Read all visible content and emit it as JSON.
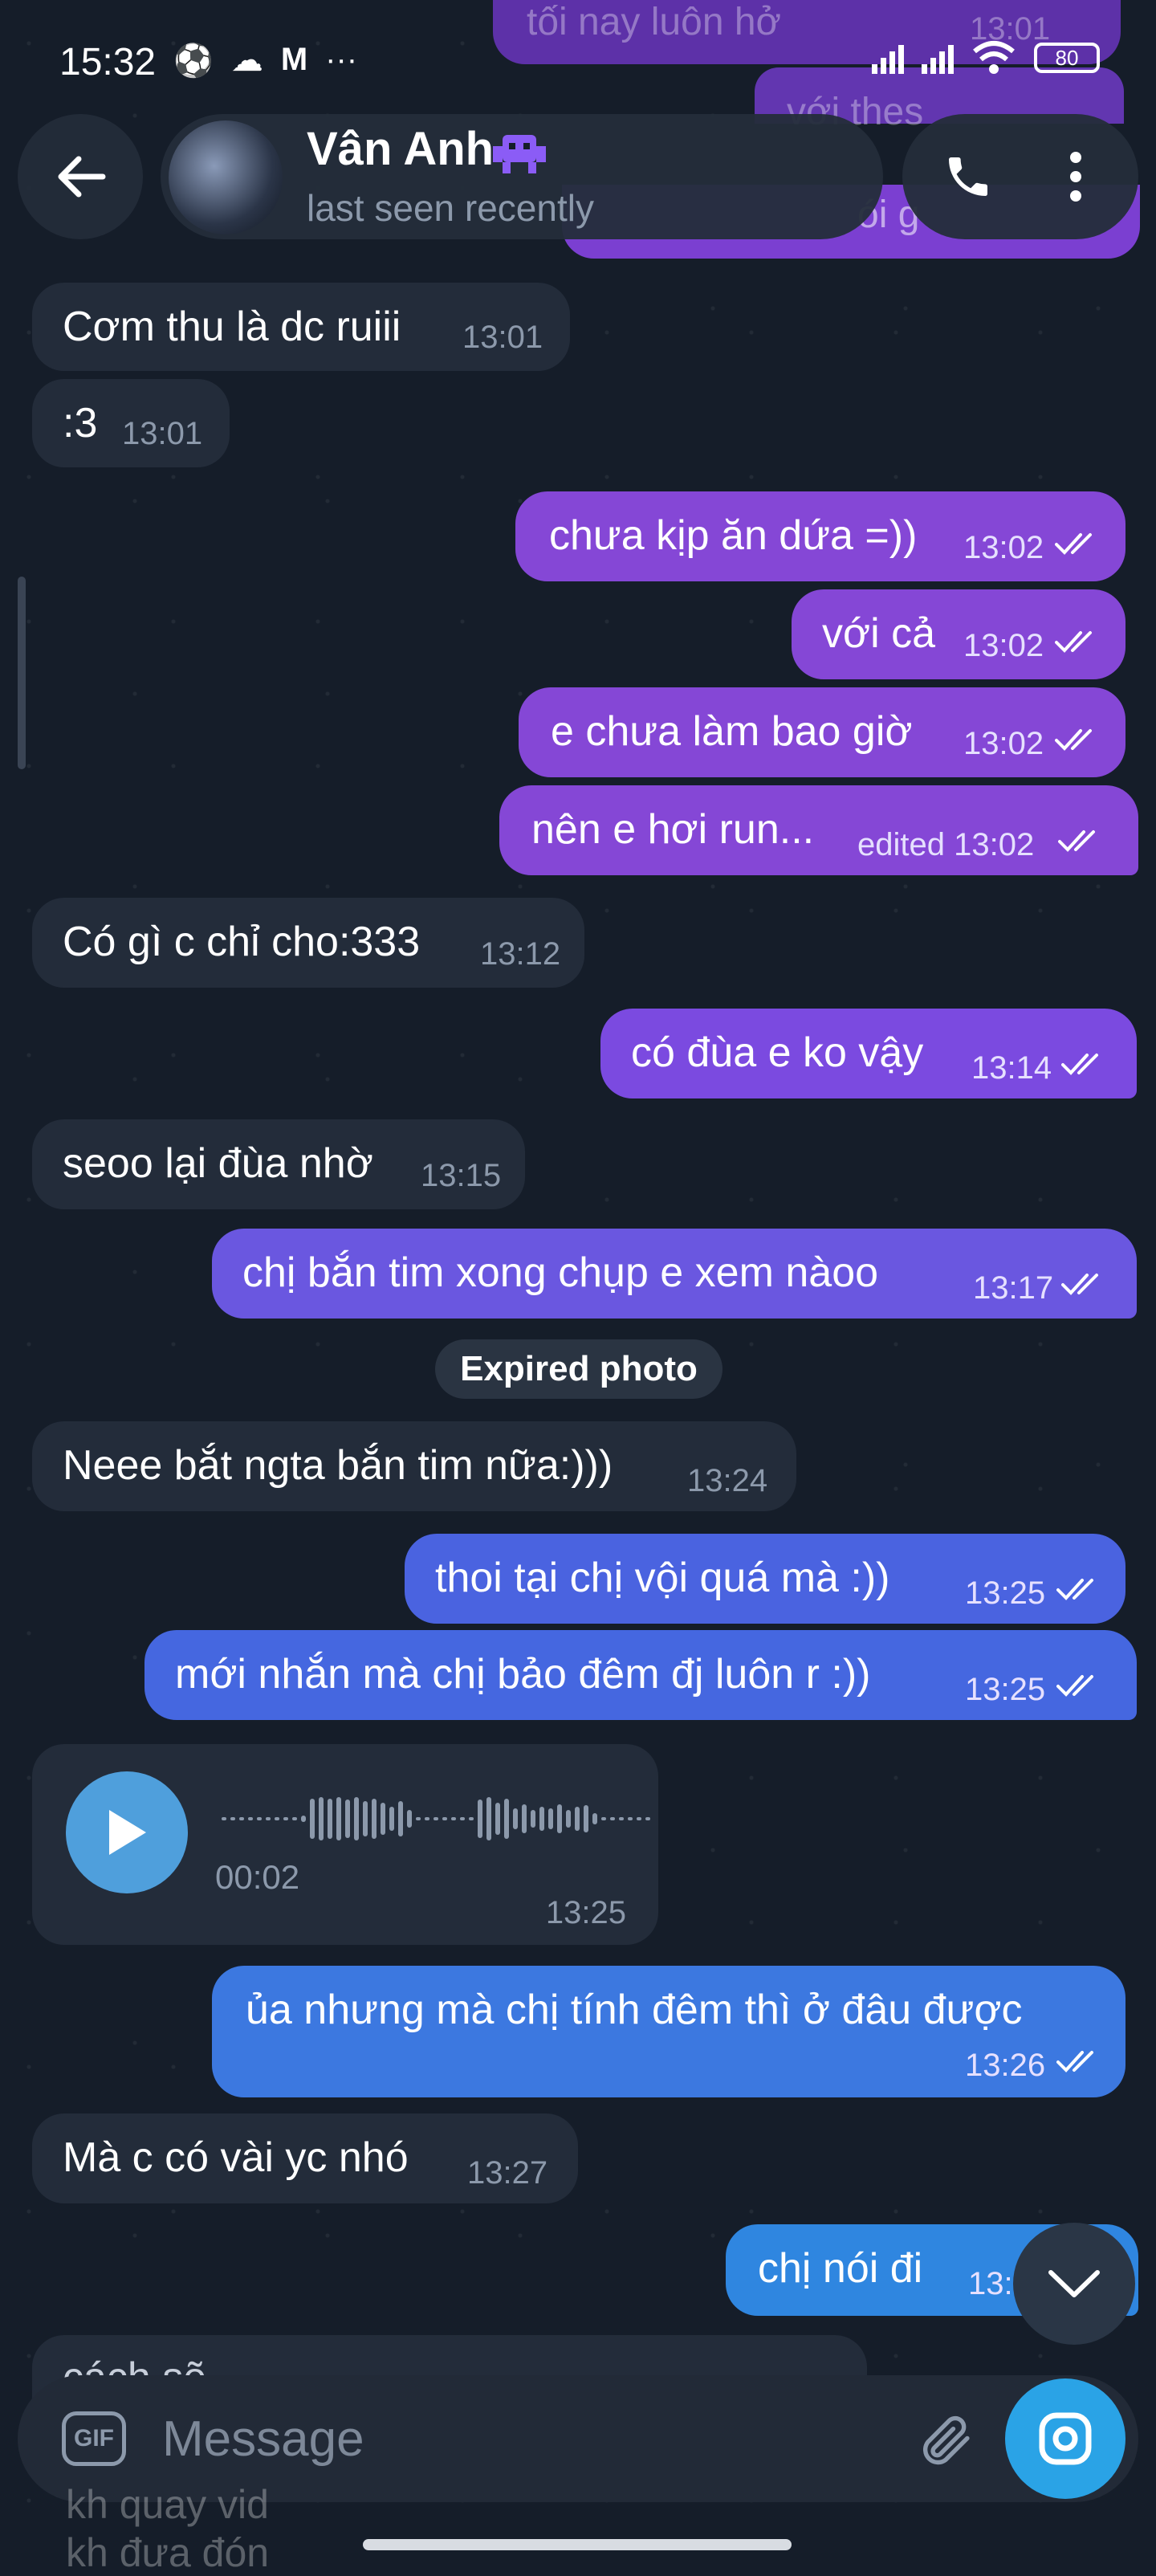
{
  "status_bar": {
    "time": "15:32",
    "battery": "80",
    "icons": [
      "soccer-ball-icon",
      "cloud-icon",
      "gmail-icon",
      "more-dots-icon",
      "signal-icon",
      "signal-icon",
      "wifi-icon",
      "battery-icon"
    ]
  },
  "header": {
    "contact_name": "Vân Anh",
    "contact_status": "last seen recently"
  },
  "background_messages": [
    {
      "text": "tối nay luôn hở",
      "time": "13:01"
    },
    {
      "text": "với thes"
    },
    {
      "text": "ói g"
    }
  ],
  "messages": [
    {
      "dir": "in",
      "text": "Cơm thu là dc ruiii",
      "time": "13:01"
    },
    {
      "dir": "in",
      "text": ":3",
      "time": "13:01"
    },
    {
      "dir": "out",
      "text": "chưa kịp ăn dứa =))",
      "time": "13:02"
    },
    {
      "dir": "out",
      "text": "với cả",
      "time": "13:02"
    },
    {
      "dir": "out",
      "text": "e chưa làm bao giờ",
      "time": "13:02"
    },
    {
      "dir": "out",
      "text": "nên e hơi run...",
      "time": "edited 13:02"
    },
    {
      "dir": "in",
      "text": "Có gì c chỉ cho:333",
      "time": "13:12"
    },
    {
      "dir": "out",
      "text": "có đùa e ko vậy",
      "time": "13:14"
    },
    {
      "dir": "in",
      "text": "seoo lại đùa nhờ",
      "time": "13:15"
    },
    {
      "dir": "out",
      "text": "chị bắn tim xong chụp e xem nàoo",
      "time": "13:17"
    },
    {
      "dir": "in",
      "text": "Neee bắt ngta bắn tim nữa:)))",
      "time": "13:24"
    },
    {
      "dir": "out",
      "text": "thoi tại chị vội quá mà :))",
      "time": "13:25"
    },
    {
      "dir": "out",
      "text": "mới nhắn mà chị bảo đêm đj luôn r :))",
      "time": "13:25"
    },
    {
      "dir": "out",
      "text": "ủa nhưng mà chị tính đêm thì ở đâu được",
      "time": "13:26"
    },
    {
      "dir": "in",
      "text": "Mà c có vài yc nhó",
      "time": "13:27"
    },
    {
      "dir": "out",
      "text": "chị nói đi",
      "time": "13:"
    }
  ],
  "system": {
    "expired_photo": "Expired photo"
  },
  "voice_message": {
    "duration": "00:02",
    "time": "13:25"
  },
  "composer": {
    "placeholder": "Message",
    "gif_label": "GIF"
  },
  "below_composer": [
    "cách sẽ",
    "kh quay vid",
    "kh đưa đón"
  ],
  "colors": {
    "background": "#151d29",
    "incoming_bubble": "#232c3a",
    "outgoing_purple": "#8547d6",
    "outgoing_indigo": "#6a57e0",
    "outgoing_blue": "#3f6fe0",
    "accent": "#2aa3e6"
  }
}
